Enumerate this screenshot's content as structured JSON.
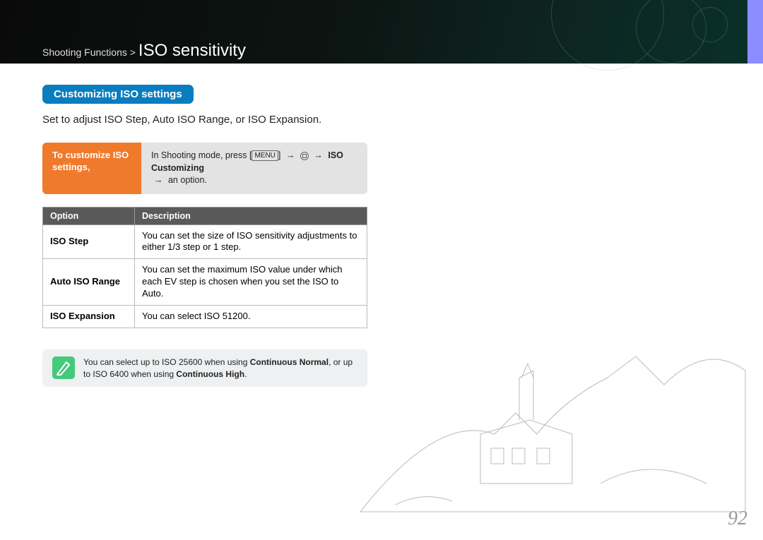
{
  "header": {
    "breadcrumb": "Shooting Functions >",
    "title": "ISO sensitivity"
  },
  "section": {
    "pill": "Customizing ISO settings",
    "intro": "Set to adjust ISO Step, Auto ISO Range, or ISO Expansion."
  },
  "instruction": {
    "left": "To customize ISO settings,",
    "right_pre": "In Shooting mode, press [",
    "menu_key": "MENU",
    "right_mid": "]",
    "target": "ISO Customizing",
    "right_post": "an option."
  },
  "table": {
    "head_option": "Option",
    "head_desc": "Description",
    "rows": [
      {
        "option": "ISO Step",
        "desc": "You can set the size of ISO sensitivity adjustments to either 1/3 step or 1 step."
      },
      {
        "option": "Auto ISO Range",
        "desc": "You can set the maximum ISO value under which each EV step is chosen when you set the ISO to Auto."
      },
      {
        "option": "ISO Expansion",
        "desc": "You can select ISO 51200."
      }
    ]
  },
  "note": {
    "pre": "You can select up to ISO 25600 when using ",
    "bold1": "Continuous Normal",
    "mid": ", or up to ISO 6400 when using ",
    "bold2": "Continuous High",
    "post": "."
  },
  "page_number": "92"
}
